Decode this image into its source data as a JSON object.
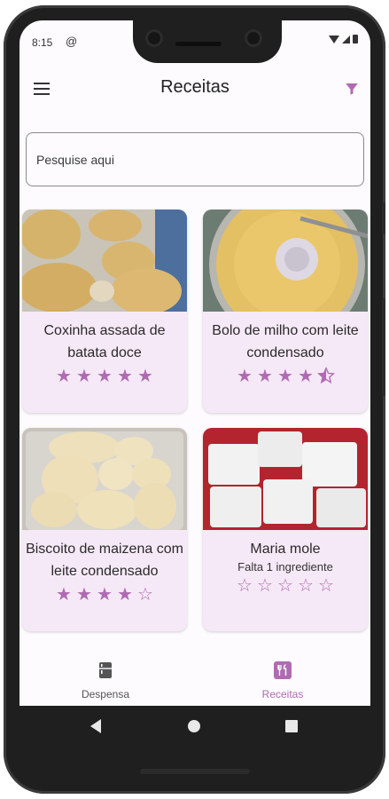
{
  "status_bar": {
    "time": "8:15",
    "notification_icon": "at-icon"
  },
  "app_bar": {
    "title": "Receitas",
    "menu_icon": "menu-icon",
    "filter_icon": "filter-icon"
  },
  "search": {
    "placeholder": "Pesquise aqui"
  },
  "recipes": [
    {
      "title": "Coxinha assada de batata doce",
      "note": "",
      "rating": 5
    },
    {
      "title": "Bolo de milho com leite condensado",
      "note": "",
      "rating": 4.5
    },
    {
      "title": "Biscoito de maizena com leite condensado",
      "note": "",
      "rating": 4
    },
    {
      "title": "Maria mole",
      "note": "Falta 1 ingrediente",
      "rating": 0
    }
  ],
  "bottom_nav": {
    "items": [
      {
        "label": "Despensa",
        "icon": "fridge-icon",
        "active": false
      },
      {
        "label": "Receitas",
        "icon": "restaurant-icon",
        "active": true
      }
    ]
  },
  "colors": {
    "accent": "#b06ab3",
    "card_bg": "#f6e9f7",
    "inactive": "#555555"
  }
}
